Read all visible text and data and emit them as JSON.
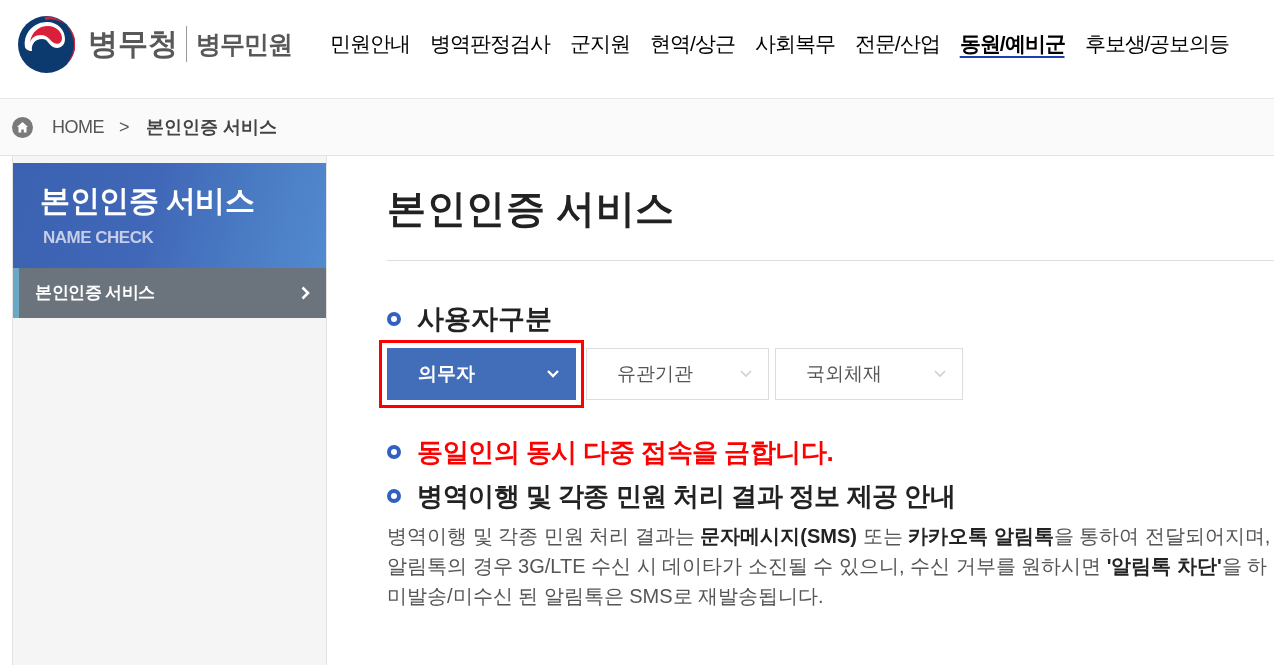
{
  "header": {
    "agency": "병무청",
    "site_name": "병무민원",
    "nav": [
      {
        "label": "민원안내",
        "selected": false
      },
      {
        "label": "병역판정검사",
        "selected": false
      },
      {
        "label": "군지원",
        "selected": false
      },
      {
        "label": "현역/상근",
        "selected": false
      },
      {
        "label": "사회복무",
        "selected": false
      },
      {
        "label": "전문/산업",
        "selected": false
      },
      {
        "label": "동원/예비군",
        "selected": true
      },
      {
        "label": "후보생/공보의등",
        "selected": false
      }
    ]
  },
  "breadcrumb": {
    "home": "HOME",
    "separator": ">",
    "current": "본인인증 서비스"
  },
  "sidebar": {
    "title": "본인인증 서비스",
    "subtitle": "NAME CHECK",
    "items": [
      {
        "label": "본인인증 서비스",
        "selected": true
      }
    ]
  },
  "page_title": "본인인증 서비스",
  "user_type": {
    "heading": "사용자구분",
    "options": [
      {
        "label": "의무자",
        "selected": true,
        "highlighted": true
      },
      {
        "label": "유관기관",
        "selected": false,
        "highlighted": false
      },
      {
        "label": "국외체재",
        "selected": false,
        "highlighted": false
      }
    ]
  },
  "warning": "동일인의 동시 다중 접속을 금합니다.",
  "info": {
    "heading": "병역이행 및 각종 민원 처리 결과 정보 제공 안내",
    "lines": [
      "병역이행 및 각종 민원 처리 결과는 **문자메시지(SMS)** 또는 **카카오톡 알림톡**을 통하여 전달되어지며,",
      "알림톡의 경우 3G/LTE 수신 시 데이타가 소진될 수 있으니, 수신 거부를 원하시면 **'알림톡 차단'**을 하",
      "미발송/미수신 된 알림톡은 SMS로 재발송됩니다."
    ]
  }
}
